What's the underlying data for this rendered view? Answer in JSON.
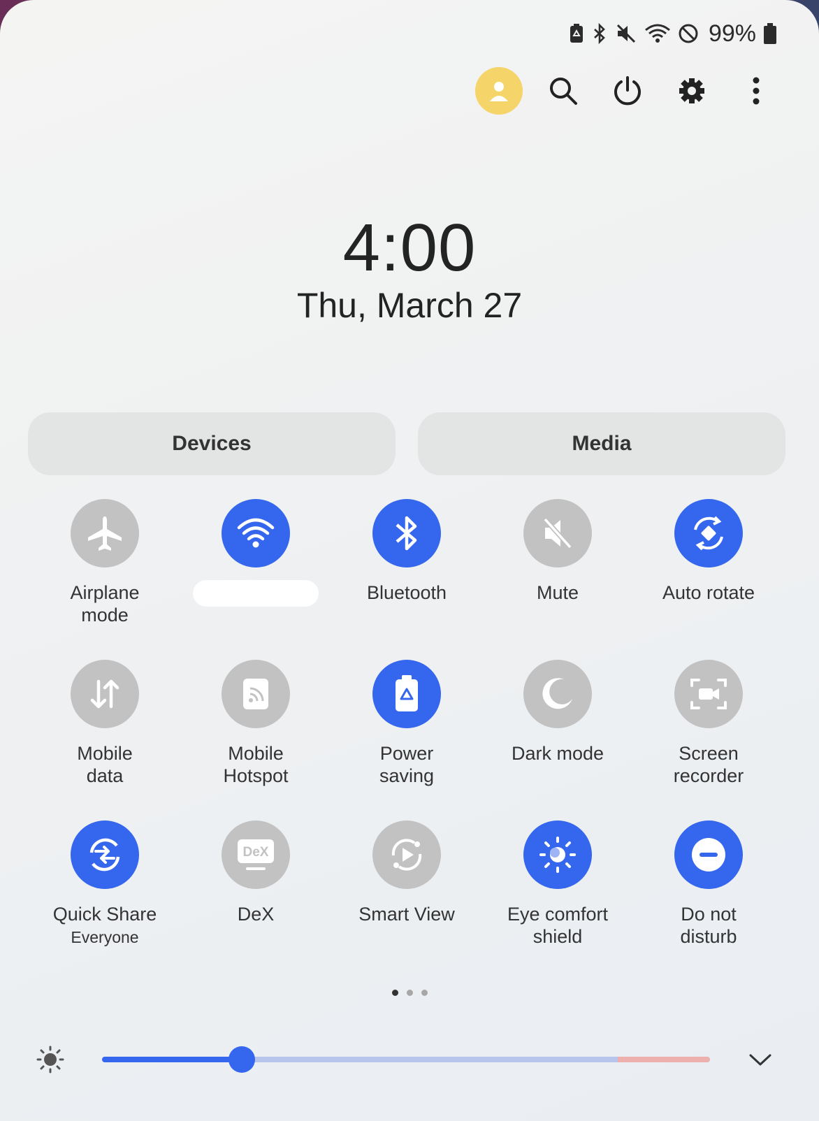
{
  "status_bar": {
    "battery_percent": "99%",
    "icons": [
      "battery-saver-icon",
      "bluetooth-icon",
      "mute-icon",
      "wifi-icon",
      "do-not-disturb-icon",
      "battery-icon"
    ]
  },
  "header": {
    "time": "4:00",
    "date": "Thu, March 27"
  },
  "buttons": {
    "devices": "Devices",
    "media": "Media"
  },
  "tiles": [
    {
      "label": "Airplane\nmode",
      "on": false,
      "icon": "airplane-icon"
    },
    {
      "label": "",
      "on": true,
      "icon": "wifi-icon"
    },
    {
      "label": "Bluetooth",
      "on": true,
      "icon": "bluetooth-icon"
    },
    {
      "label": "Mute",
      "on": false,
      "icon": "mute-icon"
    },
    {
      "label": "Auto rotate",
      "on": true,
      "icon": "auto-rotate-icon"
    },
    {
      "label": "Mobile\ndata",
      "on": false,
      "icon": "mobile-data-icon"
    },
    {
      "label": "Mobile\nHotspot",
      "on": false,
      "icon": "hotspot-icon"
    },
    {
      "label": "Power\nsaving",
      "on": true,
      "icon": "power-saving-icon"
    },
    {
      "label": "Dark mode",
      "on": false,
      "icon": "moon-icon"
    },
    {
      "label": "Screen\nrecorder",
      "on": false,
      "icon": "screen-recorder-icon"
    },
    {
      "label": "Quick Share",
      "sub": "Everyone",
      "on": true,
      "icon": "quick-share-icon"
    },
    {
      "label": "DeX",
      "on": false,
      "icon": "dex-icon"
    },
    {
      "label": "Smart View",
      "on": false,
      "icon": "smart-view-icon"
    },
    {
      "label": "Eye comfort\nshield",
      "on": true,
      "icon": "eye-comfort-icon"
    },
    {
      "label": "Do not\ndisturb",
      "on": true,
      "icon": "do-not-disturb-icon"
    }
  ],
  "pager": {
    "pages": 3,
    "current": 1
  },
  "brightness": {
    "level_fraction": 0.23
  },
  "colors": {
    "accent": "#3566ee",
    "off": "#c2c2c2",
    "avatar": "#f5d46a"
  }
}
